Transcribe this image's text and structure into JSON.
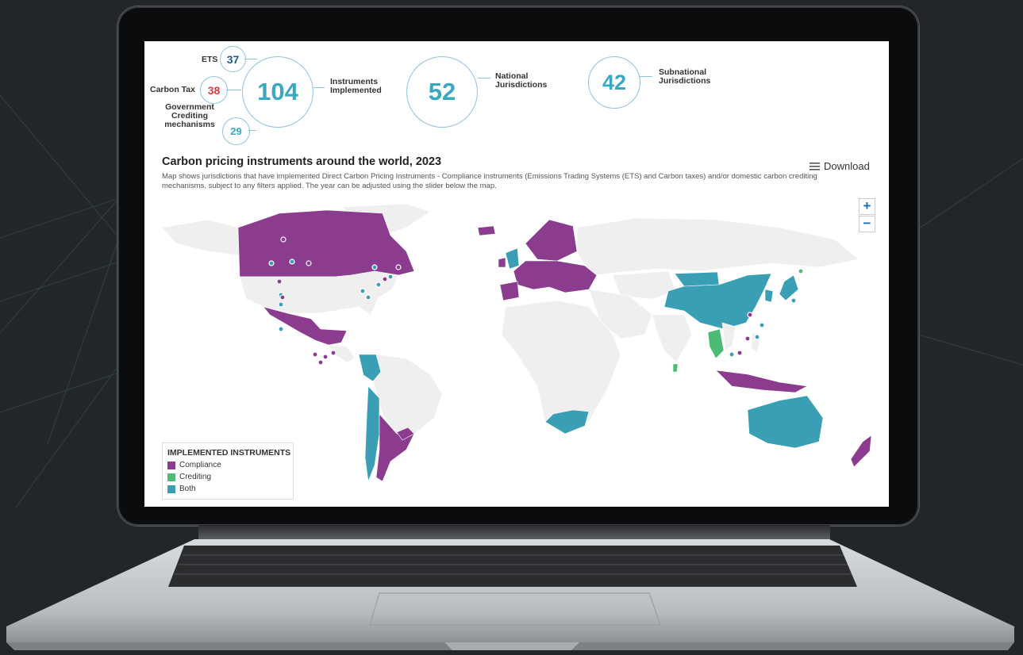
{
  "stats": {
    "ets": {
      "label": "ETS",
      "value": "37"
    },
    "carbon_tax": {
      "label": "Carbon Tax",
      "value": "38"
    },
    "crediting": {
      "label_lines": [
        "Government",
        "Crediting",
        "mechanisms"
      ],
      "value": "29"
    },
    "instruments": {
      "value": "104",
      "label_lines": [
        "Instruments",
        "Implemented"
      ]
    },
    "national": {
      "value": "52",
      "label_lines": [
        "National",
        "Jurisdictions"
      ]
    },
    "subnational": {
      "value": "42",
      "label_lines": [
        "Subnational",
        "Jurisdictions"
      ]
    }
  },
  "map": {
    "title": "Carbon pricing instruments around the world, 2023",
    "description": "Map shows jurisdictions that have implemented Direct Carbon Pricing Instruments - Compliance instruments (Emissions Trading Systems (ETS) and Carbon taxes) and/or domestic carbon crediting mechanisms, subject to any filters applied. The year can be adjusted using the slider below the map.",
    "download_label": "Download",
    "zoom_in": "+",
    "zoom_out": "−",
    "legend": {
      "title": "IMPLEMENTED INSTRUMENTS",
      "items": [
        {
          "label": "Compliance",
          "color": "#8b3c8f"
        },
        {
          "label": "Crediting",
          "color": "#4cbb73"
        },
        {
          "label": "Both",
          "color": "#3a9fb5"
        }
      ]
    },
    "colors": {
      "compliance": "#8b3c8f",
      "crediting": "#4cbb73",
      "both": "#3a9fb5",
      "none": "#efefef"
    }
  }
}
